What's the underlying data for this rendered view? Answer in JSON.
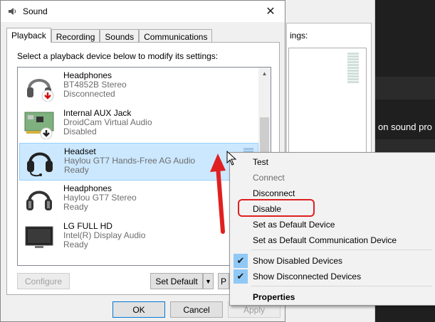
{
  "background": {
    "frag_settings": "ings:",
    "frag_sound": "on sound pro"
  },
  "dialog": {
    "title": "Sound",
    "close_glyph": "✕",
    "tabs": [
      "Playback",
      "Recording",
      "Sounds",
      "Communications"
    ],
    "active_tab": "Playback",
    "instructions": "Select a playback device below to modify its settings:",
    "devices": [
      {
        "name": "Headphones",
        "sub": "BT4852B Stereo",
        "status": "Disconnected",
        "icon": "headphones-disconnected-icon"
      },
      {
        "name": "Internal AUX Jack",
        "sub": "DroidCam Virtual Audio",
        "status": "Disabled",
        "icon": "circuit-board-disabled-icon"
      },
      {
        "name": "Headset",
        "sub": "Haylou GT7 Hands-Free AG Audio",
        "status": "Ready",
        "icon": "headset-icon",
        "selected": true
      },
      {
        "name": "Headphones",
        "sub": "Haylou GT7 Stereo",
        "status": "Ready",
        "icon": "headphones-icon"
      },
      {
        "name": "LG FULL HD",
        "sub": "Intel(R) Display Audio",
        "status": "Ready",
        "icon": "monitor-icon"
      }
    ],
    "buttons": {
      "configure": "Configure",
      "set_default": "Set Default",
      "properties_partial": "P",
      "ok": "OK",
      "cancel": "Cancel",
      "apply": "Apply"
    }
  },
  "context_menu": {
    "items": [
      {
        "label": "Test",
        "enabled": true
      },
      {
        "label": "Connect",
        "enabled": false
      },
      {
        "label": "Disconnect",
        "enabled": true
      },
      {
        "label": "Disable",
        "enabled": true,
        "highlighted": true
      },
      {
        "label": "Set as Default Device",
        "enabled": true
      },
      {
        "label": "Set as Default Communication Device",
        "enabled": true
      },
      {
        "label": "Show Disabled Devices",
        "checked": true
      },
      {
        "label": "Show Disconnected Devices",
        "checked": true
      },
      {
        "label": "Properties",
        "bold": true
      }
    ],
    "check_glyph": "✔"
  },
  "colors": {
    "selection": "#cce8ff",
    "annotation_red": "#e02020",
    "check_bg": "#90c8f6"
  }
}
